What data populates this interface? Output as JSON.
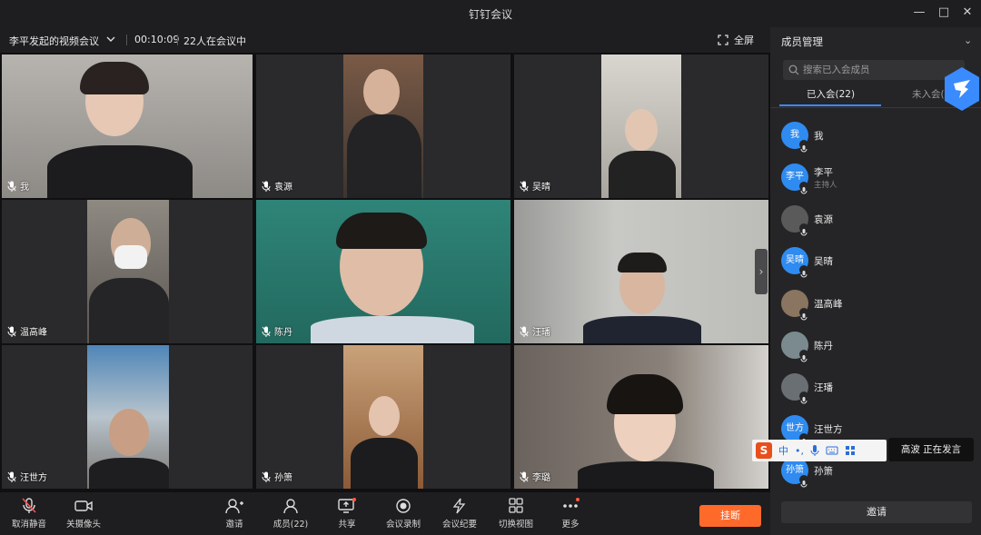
{
  "window": {
    "title": "钉钉会议"
  },
  "meeting": {
    "topic": "李平发起的视频会议",
    "timer": "00:10:09",
    "participant_count": "22人在会议中",
    "fullscreen_label": "全屏"
  },
  "tiles": [
    {
      "name": "我",
      "bg": "#9c9a98"
    },
    {
      "name": "袁源",
      "bg": "#2a2a2c"
    },
    {
      "name": "吴晴",
      "bg": "#2a2a2c"
    },
    {
      "name": "温高峰",
      "bg": "#2a2a2c"
    },
    {
      "name": "陈丹",
      "bg": "#2f7f73"
    },
    {
      "name": "汪璠",
      "bg": "#b9b9b6"
    },
    {
      "name": "汪世方",
      "bg": "#2a2a2c"
    },
    {
      "name": "孙箫",
      "bg": "#2a2a2c"
    },
    {
      "name": "李璐",
      "bg": "#77706a"
    }
  ],
  "toolbar": {
    "unmute": "取消静音",
    "camera_off": "关摄像头",
    "invite": "邀请",
    "members": "成员(22)",
    "share": "共享",
    "record": "会议录制",
    "minutes": "会议纪要",
    "switch_view": "切换视图",
    "more": "更多",
    "leave": "挂断"
  },
  "panel": {
    "title": "成员管理",
    "search_placeholder": "搜索已入会成员",
    "tab_joined": "已入会(22)",
    "tab_not_joined": "未入会(0",
    "invite": "邀请",
    "members": [
      {
        "avatar_text": "我",
        "name": "我",
        "role": "",
        "avatar_color": "#2f8bf0"
      },
      {
        "avatar_text": "李平",
        "name": "李平",
        "role": "主持人",
        "avatar_color": "#2f8bf0"
      },
      {
        "avatar_text": "",
        "name": "袁源",
        "role": "",
        "avatar_color": "#5a5a5a"
      },
      {
        "avatar_text": "吴晴",
        "name": "吴晴",
        "role": "",
        "avatar_color": "#2f8bf0"
      },
      {
        "avatar_text": "",
        "name": "温高峰",
        "role": "",
        "avatar_color": "#8a7560"
      },
      {
        "avatar_text": "",
        "name": "陈丹",
        "role": "",
        "avatar_color": "#7a8a8f"
      },
      {
        "avatar_text": "",
        "name": "汪璠",
        "role": "",
        "avatar_color": "#6a6f73"
      },
      {
        "avatar_text": "世方",
        "name": "汪世方",
        "role": "",
        "avatar_color": "#2f8bf0"
      },
      {
        "avatar_text": "孙箫",
        "name": "孙箫",
        "role": "",
        "avatar_color": "#2f8bf0"
      }
    ]
  },
  "ime": {
    "mode": "中",
    "punct": "•,"
  },
  "speaking": "高波  正在发言"
}
